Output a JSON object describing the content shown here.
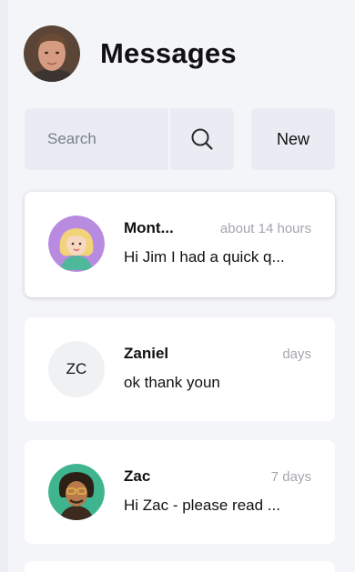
{
  "header": {
    "title": "Messages"
  },
  "search": {
    "placeholder": "Search"
  },
  "toolbar": {
    "new_label": "New"
  },
  "conversations": [
    {
      "name": "Mont...",
      "time": "about 14 hours",
      "preview": "Hi Jim I had a quick q...",
      "avatar": "illustrated-woman"
    },
    {
      "name": "Zaniel",
      "time": "days",
      "preview": "ok thank youn",
      "initials": "ZC"
    },
    {
      "name": "Zac",
      "time": "7 days",
      "preview": "Hi Zac - please read ...",
      "avatar": "illustrated-man"
    }
  ],
  "colors": {
    "background": "#f4f5f9",
    "card": "#ffffff",
    "control": "#e9ecf3",
    "muted": "#a3a6ad",
    "text": "#111111"
  }
}
